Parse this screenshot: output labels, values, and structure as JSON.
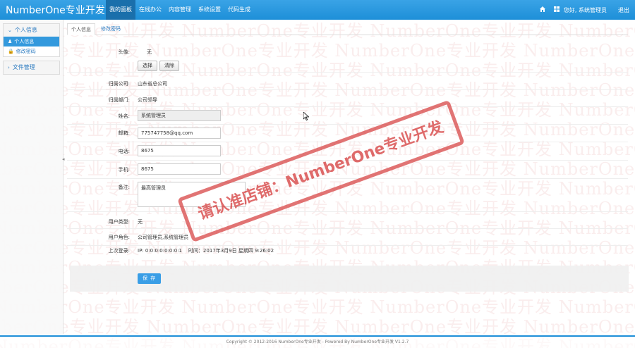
{
  "brand": "NumberOne专业开发",
  "watermark_text": "NumberOne专业开发",
  "topnav": {
    "items": [
      {
        "label": "我的面板",
        "active": true
      },
      {
        "label": "在线办公",
        "active": false
      },
      {
        "label": "内容管理",
        "active": false
      },
      {
        "label": "系统设置",
        "active": false
      },
      {
        "label": "代码生成",
        "active": false
      }
    ],
    "greeting": "您好, 系统管理员",
    "logout": "退出"
  },
  "sidebar": {
    "groups": [
      {
        "title": "个人信息",
        "items": [
          {
            "label": "个人信息",
            "active": true
          },
          {
            "label": "修改密码",
            "active": false
          }
        ]
      },
      {
        "title": "文件管理",
        "items": []
      }
    ]
  },
  "tabs": [
    {
      "label": "个人信息",
      "active": true
    },
    {
      "label": "修改密码",
      "active": false
    }
  ],
  "form": {
    "avatar_label": "头像:",
    "avatar_value": "无",
    "select_btn": "选择",
    "clear_btn": "清除",
    "company_label": "归属公司:",
    "company_value": "山东省总公司",
    "dept_label": "归属部门:",
    "dept_value": "公司领导",
    "name_label": "姓名:",
    "name_value": "系统管理员",
    "email_label": "邮箱:",
    "email_value": "775747758@qq.com",
    "phone_label": "电话:",
    "phone_value": "8675",
    "mobile_label": "手机:",
    "mobile_value": "8675",
    "remarks_label": "备注:",
    "remarks_value": "最高管理员",
    "usertype_label": "用户类型:",
    "usertype_value": "无",
    "roles_label": "用户角色:",
    "roles_value": "公司管理员,系统管理员",
    "lastlogin_label": "上次登录:",
    "lastlogin_value": "IP: 0:0:0:0:0:0:0:1    时间：2017年3月9日 星期四 9:26:02",
    "save_btn": "保 存"
  },
  "stamp": "请认准店铺：NumberOne专业开发",
  "footer": "Copyright © 2012-2016 NumberOne专业开发 - Powered By NumberOne专业开发 V1.2.7"
}
